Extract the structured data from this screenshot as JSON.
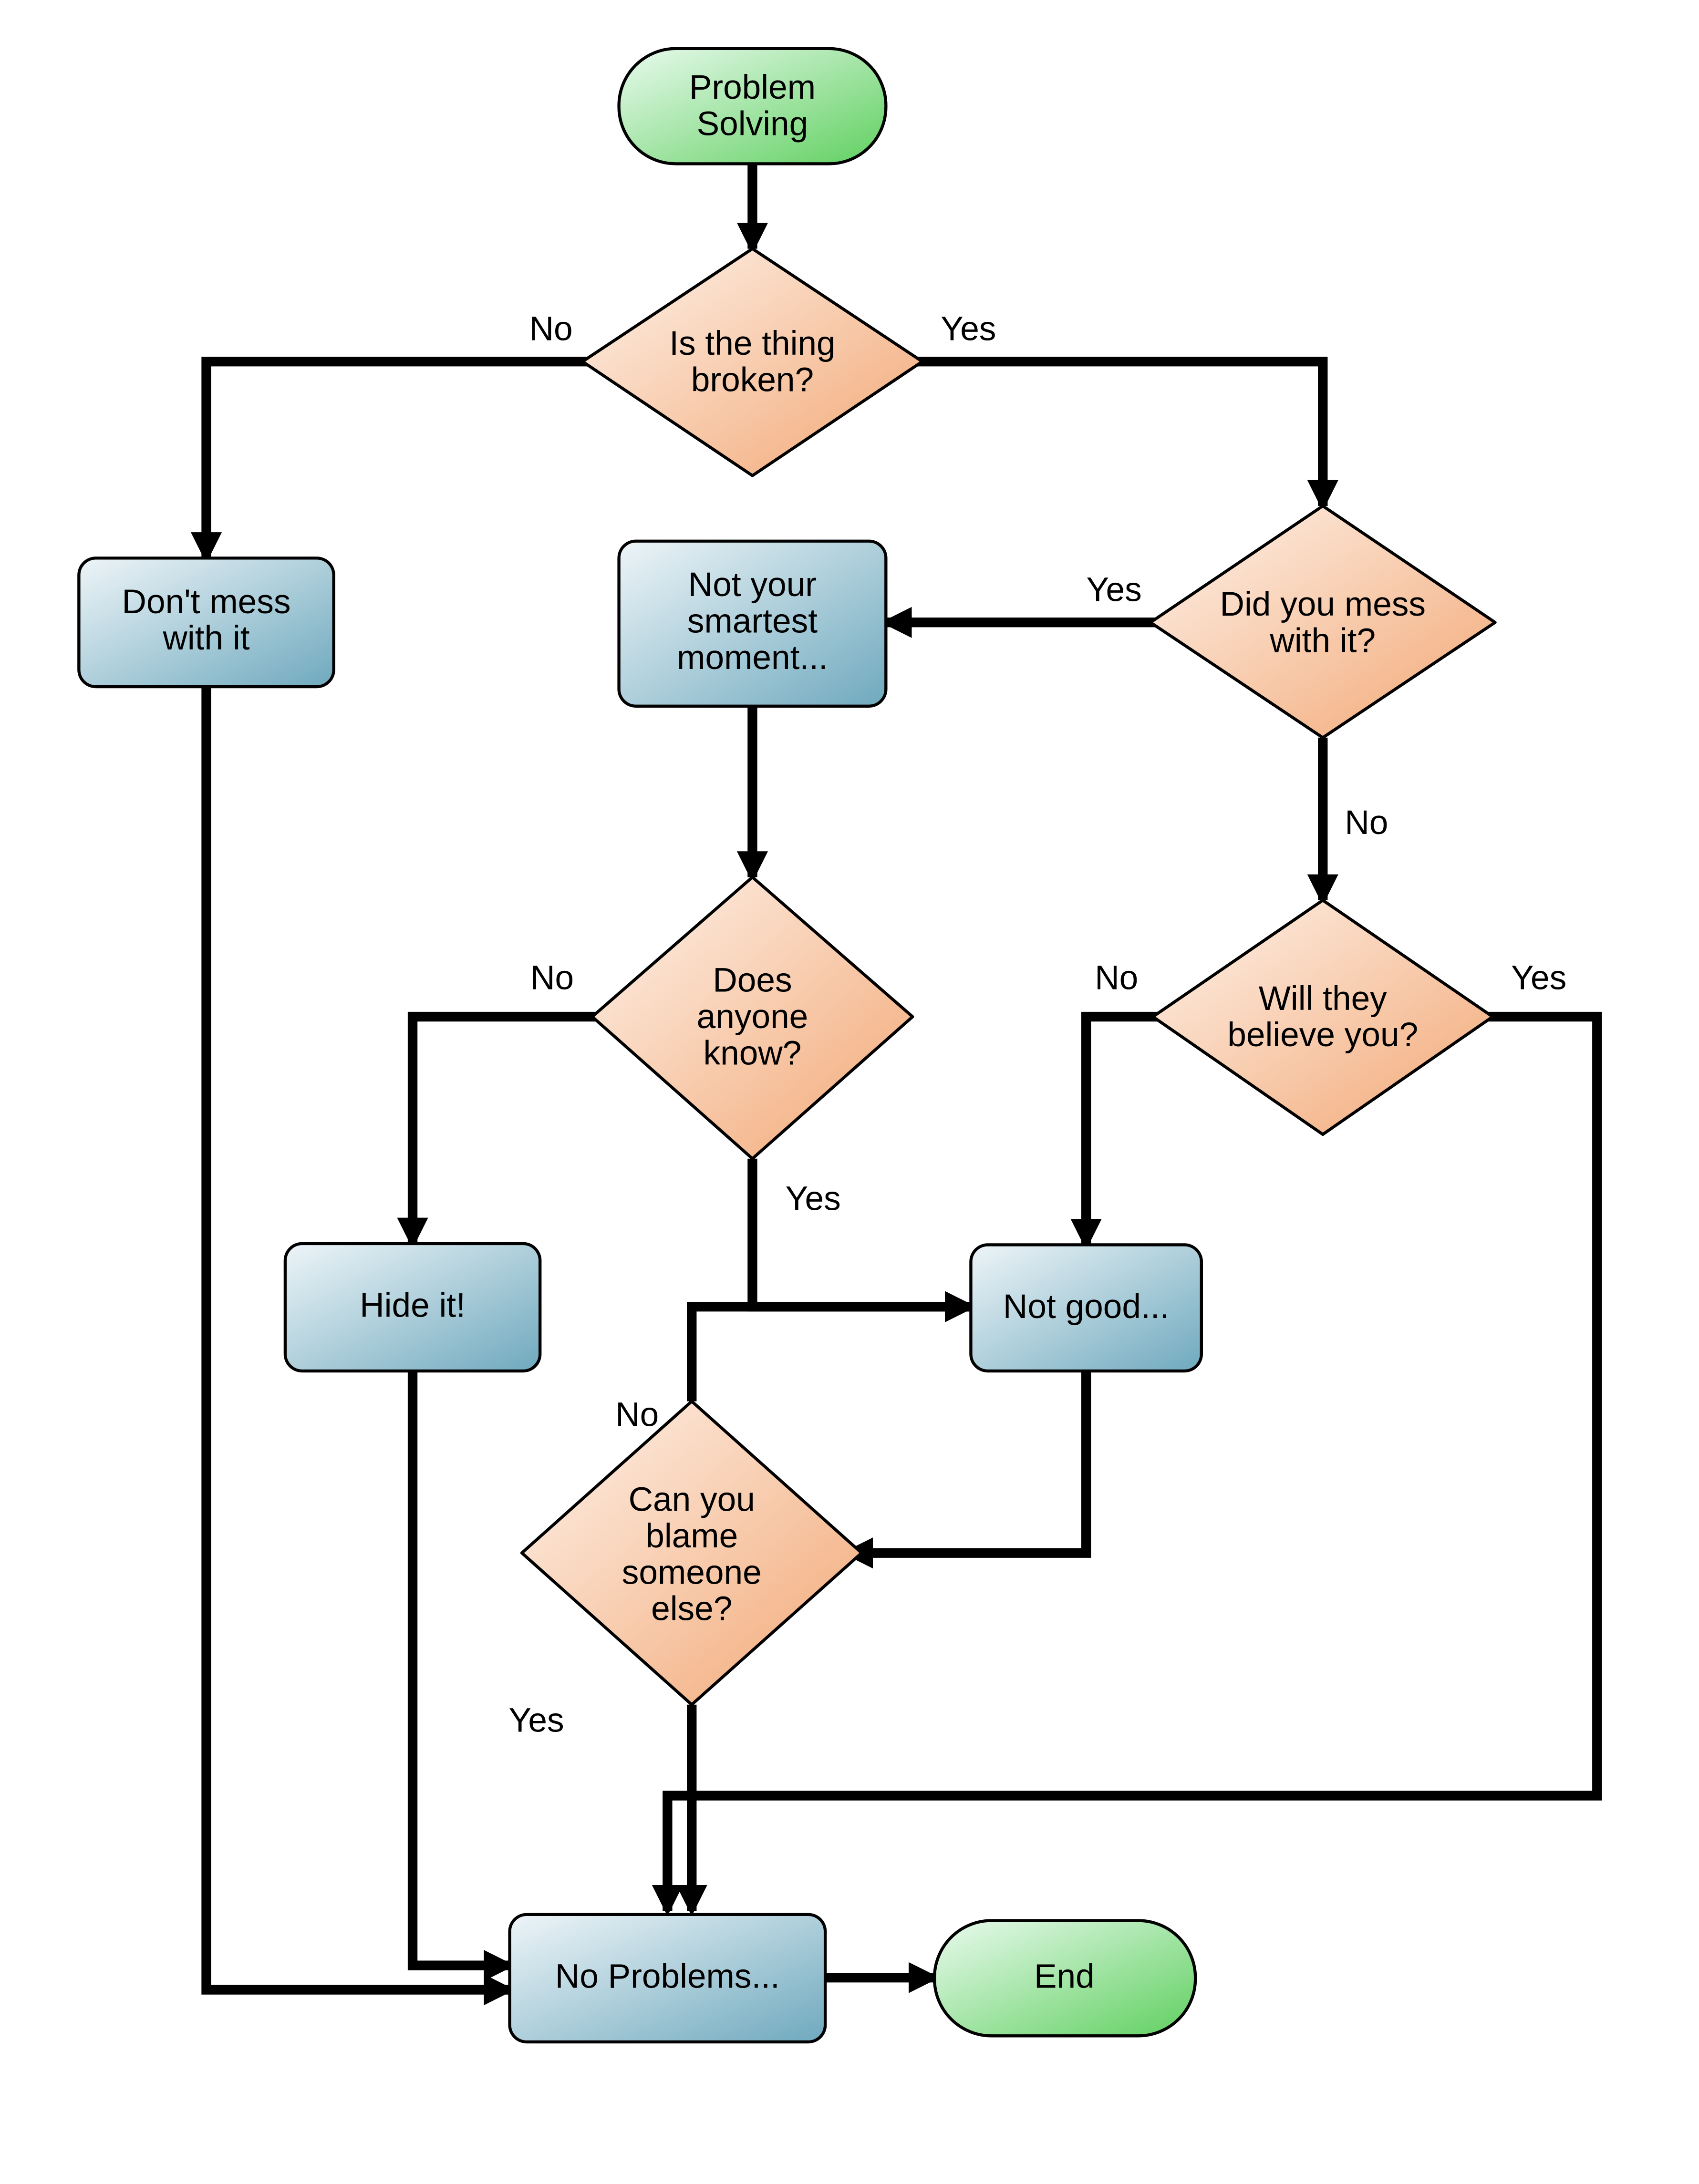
{
  "chart_data": {
    "type": "flowchart",
    "title": "Problem Solving",
    "nodes": [
      {
        "id": "start",
        "shape": "terminator",
        "text": [
          "Problem",
          "Solving"
        ]
      },
      {
        "id": "is_broken",
        "shape": "decision",
        "text": [
          "Is the thing",
          "broken?"
        ]
      },
      {
        "id": "dont_mess",
        "shape": "process",
        "text": [
          "Don't mess",
          "with it"
        ]
      },
      {
        "id": "did_you_mess",
        "shape": "decision",
        "text": [
          "Did you mess",
          "with it?"
        ]
      },
      {
        "id": "not_smartest",
        "shape": "process",
        "text": [
          "Not your",
          "smartest",
          "moment..."
        ]
      },
      {
        "id": "does_anyone",
        "shape": "decision",
        "text": [
          "Does",
          "anyone",
          "know?"
        ]
      },
      {
        "id": "will_believe",
        "shape": "decision",
        "text": [
          "Will they",
          "believe you?"
        ]
      },
      {
        "id": "hide_it",
        "shape": "process",
        "text": [
          "Hide it!"
        ]
      },
      {
        "id": "not_good",
        "shape": "process",
        "text": [
          "Not good..."
        ]
      },
      {
        "id": "can_blame",
        "shape": "decision",
        "text": [
          "Can you",
          "blame",
          "someone",
          "else?"
        ]
      },
      {
        "id": "no_problems",
        "shape": "process",
        "text": [
          "No Problems..."
        ]
      },
      {
        "id": "end",
        "shape": "terminator",
        "text": [
          "End"
        ]
      }
    ],
    "edges": [
      {
        "from": "start",
        "to": "is_broken",
        "label": ""
      },
      {
        "from": "is_broken",
        "to": "dont_mess",
        "label": "No"
      },
      {
        "from": "is_broken",
        "to": "did_you_mess",
        "label": "Yes"
      },
      {
        "from": "did_you_mess",
        "to": "not_smartest",
        "label": "Yes"
      },
      {
        "from": "did_you_mess",
        "to": "will_believe",
        "label": "No"
      },
      {
        "from": "not_smartest",
        "to": "does_anyone",
        "label": ""
      },
      {
        "from": "does_anyone",
        "to": "hide_it",
        "label": "No"
      },
      {
        "from": "does_anyone",
        "to": "not_good",
        "label": "Yes"
      },
      {
        "from": "will_believe",
        "to": "not_good",
        "label": "No"
      },
      {
        "from": "will_believe",
        "to": "no_problems",
        "label": "Yes"
      },
      {
        "from": "not_good",
        "to": "can_blame",
        "label": ""
      },
      {
        "from": "can_blame",
        "to": "not_good",
        "label": "No"
      },
      {
        "from": "can_blame",
        "to": "no_problems",
        "label": "Yes"
      },
      {
        "from": "hide_it",
        "to": "no_problems",
        "label": ""
      },
      {
        "from": "dont_mess",
        "to": "no_problems",
        "label": ""
      },
      {
        "from": "no_problems",
        "to": "end",
        "label": ""
      }
    ],
    "labels": {
      "yes": "Yes",
      "no": "No"
    }
  }
}
